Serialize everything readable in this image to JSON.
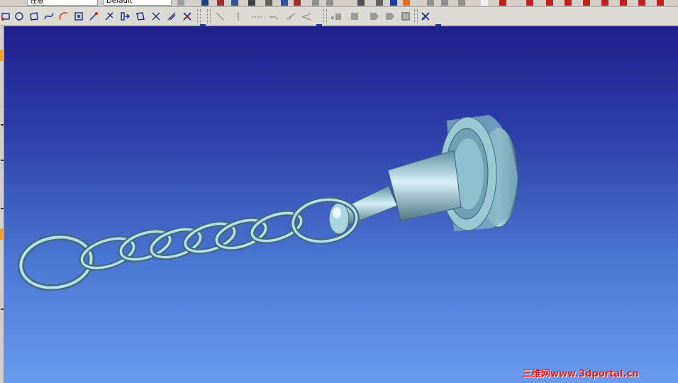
{
  "toolbar_top": {
    "combo_left": "任意",
    "combo_style": "Default"
  },
  "toolbar_second": {
    "groups": [
      {
        "name": "sketch-tools",
        "icons": [
          "rectangle-tool-icon",
          "circle-tool-icon",
          "polygon-tool-icon",
          "spline-tool-icon",
          "arc-tool-icon",
          "offset-tool-icon",
          "line-tool-icon",
          "trim-tool-icon",
          "extend-tool-icon",
          "mirror-tool-icon",
          "fillet-tool-icon",
          "chamfer-tool-icon",
          "constraint-tool-icon",
          "dimension-tool-icon"
        ]
      },
      {
        "name": "line-types",
        "icons": [
          "diagonal-line-icon",
          "vertical-line-icon",
          "dashed-line-icon",
          "angle-line-icon",
          "tangent-line-icon",
          "bisector-line-icon"
        ]
      },
      {
        "name": "render-tools",
        "icons": [
          "shaded-solid-icon",
          "box-solid-icon",
          "face-select-icon",
          "cylinder-select-icon",
          "sphere-select-icon",
          "pick-filter-icon"
        ]
      }
    ]
  },
  "viewport": {
    "background_top": "#1f1f8d",
    "background_bottom": "#6a9bec",
    "model": "chain-with-pin",
    "model_color": "#8fc0cf"
  },
  "watermark": {
    "text": "三维网www.3dportal.cn",
    "color": "#e02020"
  }
}
